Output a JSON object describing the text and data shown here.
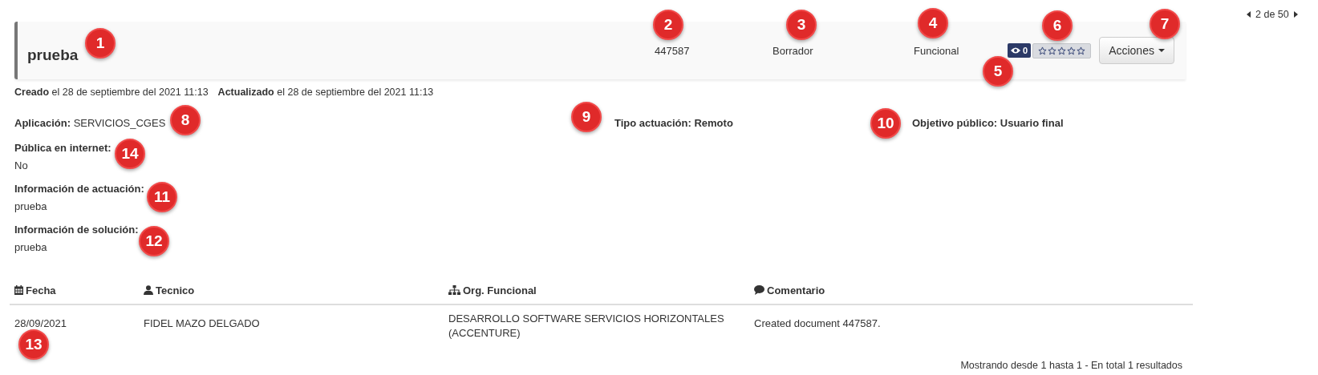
{
  "pager": {
    "text": "2 de 50"
  },
  "header": {
    "title": "prueba",
    "code": "447587",
    "status": "Borrador",
    "type": "Funcional",
    "views": "0",
    "stars": 0,
    "actions_button": "Acciones"
  },
  "dates": [
    "**Creado** el 28 de septiembre del 2021 11:13",
    "**Actualizado** el 28 de septiembre del 2021 11:13"
  ],
  "fields": [
    {
      "text": "**Aplicación:** SERVICIOS_CGES",
      "bold": false
    },
    {
      "text": "Tipo actuación: Remoto",
      "bold": true
    },
    {
      "text": "Objetivo público: Usuario final",
      "bold": true
    }
  ],
  "sections": [
    {
      "label": "Pública en internet:",
      "value": "No"
    },
    {
      "label": "Información de actuación:",
      "value": "prueba"
    },
    {
      "label": "Información de solución:",
      "value": "prueba"
    }
  ],
  "table": {
    "columns": [
      {
        "label": "Fecha"
      },
      {
        "label": "Tecnico"
      },
      {
        "label": "Org. Funcional"
      },
      {
        "label": "Comentario"
      }
    ],
    "rows": [
      [
        "28/09/2021",
        "FIDEL MAZO DELGADO",
        "DESARROLLO SOFTWARE SERVICIOS HORIZONTALES (ACCENTURE)",
        "Created document 447587."
      ]
    ]
  },
  "footer": "Mostrando desde 1 hasta 1 - En total 1 resultados",
  "markers": [
    "1",
    "2",
    "3",
    "4",
    "5",
    "6",
    "7",
    "8",
    "9",
    "10",
    "11",
    "12",
    "13",
    "14"
  ]
}
